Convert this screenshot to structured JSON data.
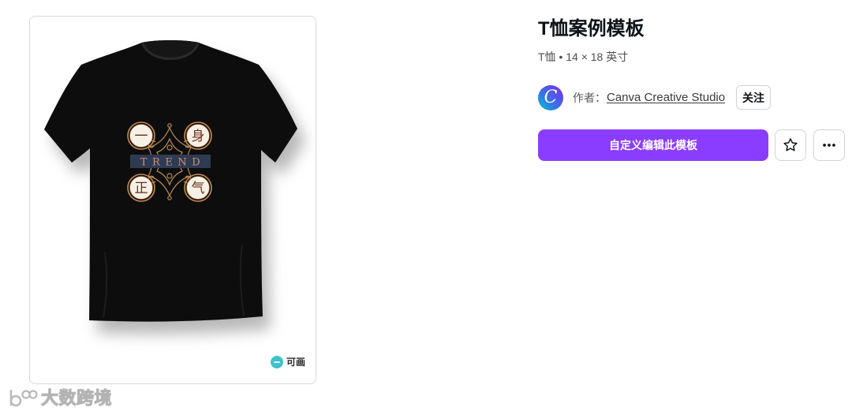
{
  "template": {
    "title": "T恤案例模板",
    "meta": "T恤 • 14 × 18 英寸"
  },
  "author": {
    "avatar_letter": "C",
    "prefix": "作者：",
    "name": "Canva Creative Studio",
    "follow_label": "关注"
  },
  "actions": {
    "customize_label": "自定义编辑此模板",
    "favorite_icon": "star-icon",
    "more_icon": "more-horizontal-icon"
  },
  "preview": {
    "design": {
      "characters": [
        "一",
        "身",
        "正",
        "气"
      ],
      "banner_text": "TREND"
    },
    "brand_logo": {
      "icon": "canva-logo-icon",
      "text": "可画"
    }
  },
  "watermark": {
    "icon": "watermark-logo-icon",
    "text": "大数跨境"
  },
  "colors": {
    "accent": "#8b3dff",
    "shirt": "#0b0b0b",
    "banner": "#2f3b52",
    "ring": "#c58b52",
    "brand_teal": "#3fc1c9"
  }
}
